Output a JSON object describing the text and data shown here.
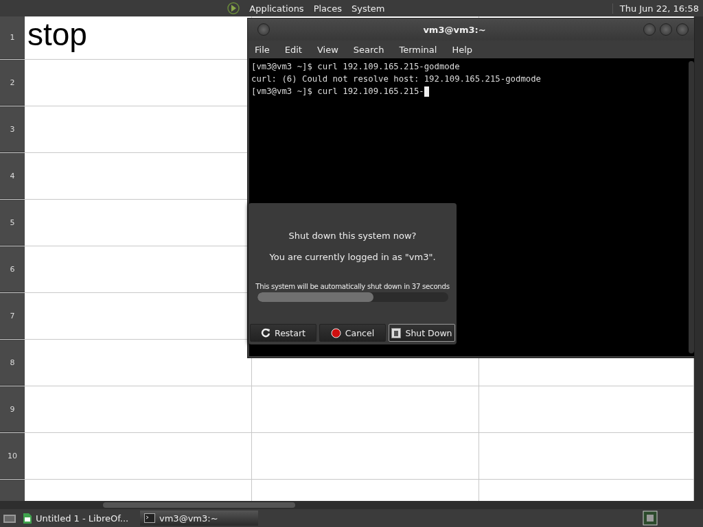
{
  "top_panel": {
    "menus": [
      "Applications",
      "Places",
      "System"
    ],
    "clock": "Thu Jun 22, 16:58"
  },
  "spreadsheet": {
    "rows": [
      {
        "number": "1",
        "cell": "stop"
      },
      {
        "number": "2",
        "cell": ""
      },
      {
        "number": "3",
        "cell": ""
      },
      {
        "number": "4",
        "cell": ""
      },
      {
        "number": "5",
        "cell": ""
      },
      {
        "number": "6",
        "cell": ""
      },
      {
        "number": "7",
        "cell": ""
      },
      {
        "number": "8",
        "cell": ""
      },
      {
        "number": "9",
        "cell": ""
      },
      {
        "number": "10",
        "cell": ""
      }
    ]
  },
  "terminal": {
    "title": "vm3@vm3:~",
    "menu": [
      "File",
      "Edit",
      "View",
      "Search",
      "Terminal",
      "Help"
    ],
    "lines": [
      "[vm3@vm3 ~]$ curl 192.109.165.215-godmode",
      "curl: (6) Could not resolve host: 192.109.165.215-godmode",
      "[vm3@vm3 ~]$ curl 192.109.165.215-"
    ]
  },
  "dialog": {
    "question": "Shut down this system now?",
    "info": "You are currently logged in as \"vm3\".",
    "countdown": "This system will be automatically shut down in 37 seconds",
    "progress": {
      "level": 0.61
    },
    "buttons": [
      {
        "kind": "restart",
        "label": "Restart",
        "selected": false
      },
      {
        "kind": "cancel",
        "label": "Cancel",
        "selected": false
      },
      {
        "kind": "shutdown",
        "label": "Shut Down",
        "selected": true
      }
    ]
  },
  "taskbar": {
    "tasks": [
      {
        "kind": "spreadsheet",
        "label": "Untitled 1 - LibreOf...",
        "selected": false
      },
      {
        "kind": "terminal",
        "label": "vm3@vm3:~",
        "selected": true
      }
    ]
  }
}
